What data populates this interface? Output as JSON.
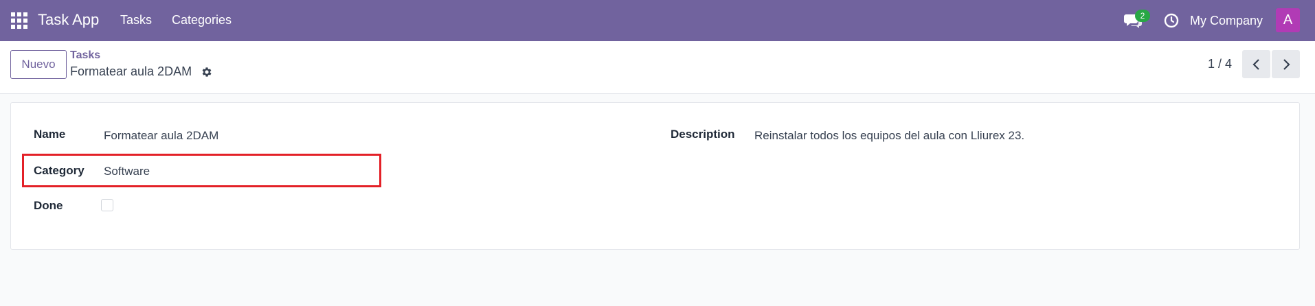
{
  "navbar": {
    "brand": "Task App",
    "links": [
      "Tasks",
      "Categories"
    ],
    "chat_badge": "2",
    "company": "My Company",
    "avatar_letter": "A",
    "icons": {
      "apps": "apps-grid-icon",
      "chat": "chat-icon",
      "clock": "clock-icon"
    },
    "bg_color": "#71639e"
  },
  "control_panel": {
    "new_button": "Nuevo",
    "breadcrumb_parent": "Tasks",
    "breadcrumb_current": "Formatear aula 2DAM",
    "pager": "1 / 4"
  },
  "form": {
    "name_label": "Name",
    "name_value": "Formatear aula 2DAM",
    "category_label": "Category",
    "category_value": "Software",
    "done_label": "Done",
    "done_checked": false,
    "description_label": "Description",
    "description_value": "Reinstalar todos los equipos del aula con Lliurex 23."
  },
  "highlight_color": "#e32027"
}
